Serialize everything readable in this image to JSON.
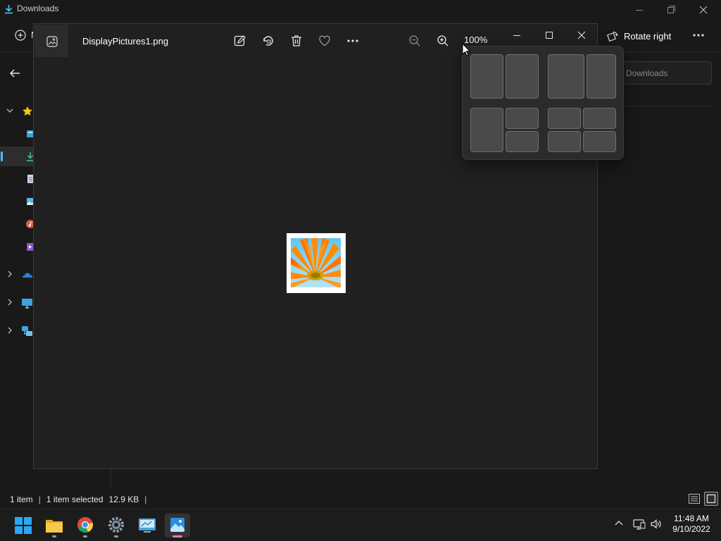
{
  "explorer": {
    "title": "Downloads",
    "new_label": "N",
    "rotate_right_label": "Rotate right",
    "search_placeholder": "Downloads",
    "status": {
      "item_count": "1 item",
      "selection": "1 item selected",
      "size": "12.9 KB",
      "separator": "|"
    },
    "nav_icons": [
      "star-icon",
      "desktop-icon",
      "download-icon",
      "document-icon",
      "pictures-icon",
      "music-icon",
      "videos-icon",
      "onedrive-icon",
      "this-pc-icon",
      "network-icon"
    ],
    "colors": {
      "accent": "#4cc2ff",
      "background": "#191919"
    }
  },
  "photos": {
    "filename": "DisplayPictures1.png",
    "zoom": "100%",
    "toolbar": [
      "edit-icon",
      "rotate-icon",
      "delete-icon",
      "favorite-icon",
      "more-icon"
    ],
    "colors": {
      "background": "#202020",
      "frame": "#ffffff"
    }
  },
  "snap_layouts": {
    "layouts": [
      "two-equal-columns",
      "two-columns-wide-right",
      "main-left-two-stacked-right",
      "four-quadrants"
    ]
  },
  "taskbar": {
    "apps": [
      "start-icon",
      "file-explorer-icon",
      "chrome-icon",
      "settings-icon",
      "control-panel-icon",
      "photos-icon"
    ],
    "time": "11:48 AM",
    "date": "9/10/2022",
    "tray": [
      "chevron-up-icon",
      "network-icon",
      "volume-icon"
    ]
  }
}
